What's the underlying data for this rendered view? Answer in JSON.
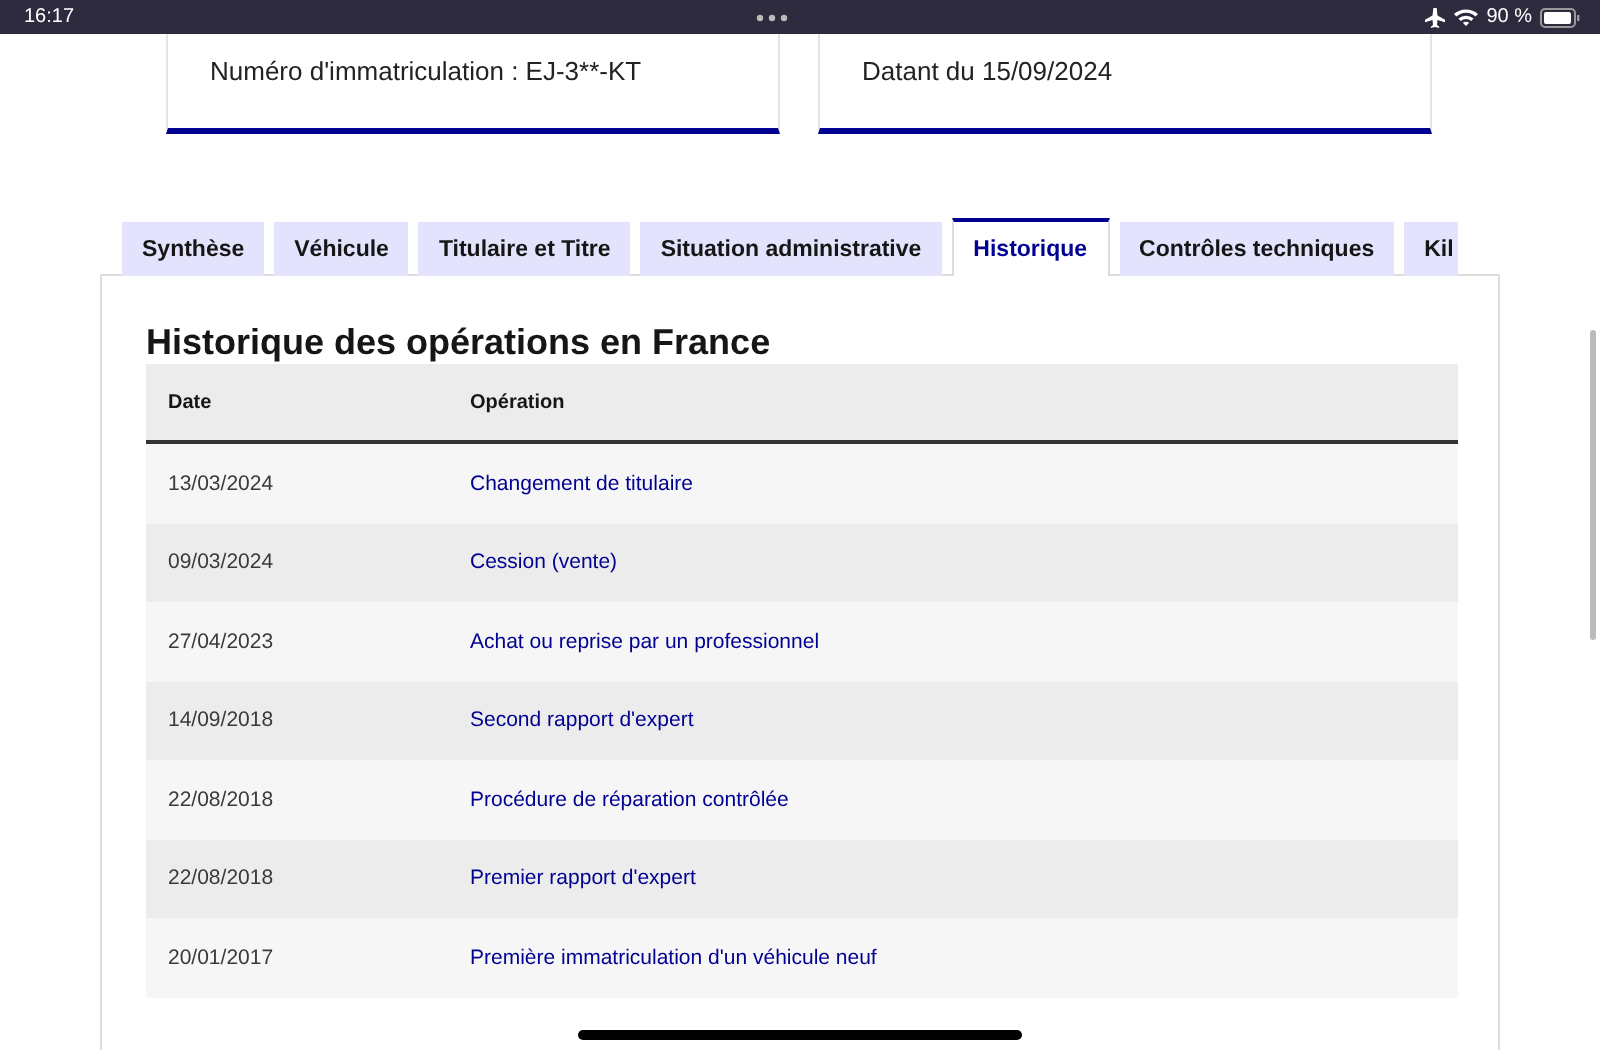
{
  "status_bar": {
    "time": "16:17",
    "battery": "90 %"
  },
  "cards": [
    {
      "text": "Numéro d'immatriculation : EJ-3**-KT"
    },
    {
      "text": "Datant du 15/09/2024"
    }
  ],
  "tabs": [
    {
      "label": "Synthèse",
      "selected": false
    },
    {
      "label": "Véhicule",
      "selected": false
    },
    {
      "label": "Titulaire et Titre",
      "selected": false
    },
    {
      "label": "Situation administrative",
      "selected": false
    },
    {
      "label": "Historique",
      "selected": true
    },
    {
      "label": "Contrôles techniques",
      "selected": false
    },
    {
      "label": "Kil",
      "selected": false
    }
  ],
  "section": {
    "title": "Historique des opérations en France"
  },
  "table": {
    "columns": [
      "Date",
      "Opération"
    ],
    "rows": [
      {
        "date": "13/03/2024",
        "operation": "Changement de titulaire"
      },
      {
        "date": "09/03/2024",
        "operation": "Cession (vente)"
      },
      {
        "date": "27/04/2023",
        "operation": "Achat ou reprise par un professionnel"
      },
      {
        "date": "14/09/2018",
        "operation": "Second rapport d'expert"
      },
      {
        "date": "22/08/2018",
        "operation": "Procédure de réparation contrôlée"
      },
      {
        "date": "22/08/2018",
        "operation": "Premier rapport d'expert"
      },
      {
        "date": "20/01/2017",
        "operation": "Première immatriculation d'un véhicule neuf"
      }
    ]
  }
}
